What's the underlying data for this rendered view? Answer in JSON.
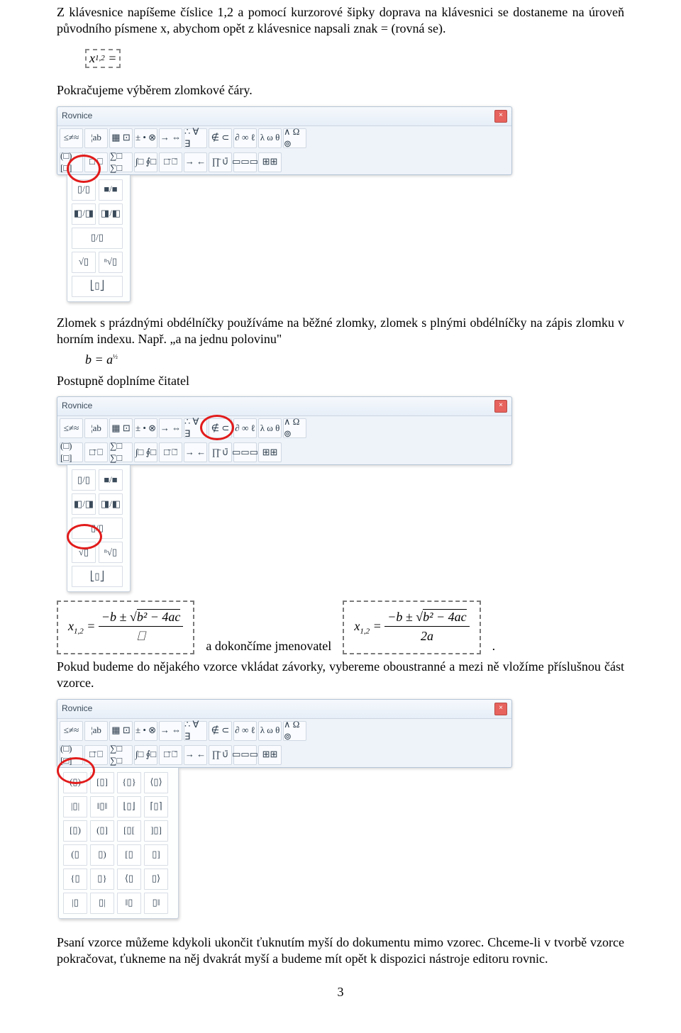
{
  "para1": "Z klávesnice napíšeme číslice 1,2 a pomocí kurzorové šipky doprava na klávesnici se dostaneme na úroveň původního písmene x, abychom opět z klávesnice napsali znak = (rovná se).",
  "sel_label": "x₁,₂ =",
  "para2": "Pokračujeme výběrem zlomkové čáry.",
  "para3": "Zlomek s prázdnými obdélníčky používáme na běžné zlomky, zlomek s plnými obdélníčky na zápis zlomku v horním indexu. Např. „a na jednu polovinu\"",
  "formula1": "b = a",
  "formula1_exp": "½",
  "para4": "Postupně doplníme čitatel",
  "mid_text": " a dokončíme jmenovatel ",
  "end_text": ".",
  "para5": "Pokud budeme do nějakého vzorce vkládat závorky, vybereme oboustranné a mezi ně vložíme příslušnou část vzorce.",
  "para6": "Psaní vzorce můžeme kdykoli ukončit ťuknutím myší do dokumentu mimo vzorec. Chceme-li v tvorbě vzorce pokračovat, ťukneme na něj dvakrát myší a budeme mít opět k dispozici nástroje editoru rovnic.",
  "page_num": "3",
  "tb_title": "Rovnice",
  "close_x": "×",
  "row1": [
    "≤≠≈",
    "¦ab",
    "▦ ⊡",
    "± • ⊗",
    "→ ⇔",
    "∴ ∀ ∃",
    "∉ ⊂",
    "∂ ∞ ℓ",
    "λ ω θ",
    "∧ Ω ⊚"
  ],
  "row2": [
    "(□) [□]",
    "□̄ ⎕",
    "∑□ ∑□",
    "∫□ ∮□",
    "□̄ ⎕̄",
    "→ ←",
    "∏̄ ∪̄",
    "▭▭▭",
    "⊞⊞"
  ],
  "drop_frac": [
    [
      "▯/▯",
      "■/■"
    ],
    [
      "◧/◨",
      "◨/◧"
    ],
    [
      "▯/▯"
    ],
    [
      "√▯",
      "ⁿ√▯"
    ],
    [
      "⎣▯⎦"
    ]
  ],
  "drop_frac2": [
    [
      "▯/▯",
      "■/■"
    ],
    [
      "◧/◨",
      "◨/◧"
    ],
    [
      "▯/▯"
    ],
    [
      "√▯",
      "ⁿ√▯"
    ],
    [
      "⎣▯⎦"
    ]
  ],
  "drop_paren": [
    [
      "(▯)",
      "[▯]",
      "{▯}",
      "⟨▯⟩"
    ],
    [
      "|▯|",
      "‖▯‖",
      "⌊▯⌋",
      "⌈▯⌉"
    ],
    [
      "[▯)",
      "(▯]",
      "[▯[",
      "]▯]"
    ],
    [
      "(▯",
      "▯)",
      "[▯",
      "▯]"
    ],
    [
      "{▯",
      "▯}",
      "⟨▯",
      "▯⟩"
    ],
    [
      "|▯",
      "▯|",
      "‖▯",
      "▯‖"
    ]
  ],
  "chart_data": {
    "type": "table",
    "note": "document screenshots; no quantitative chart data"
  }
}
